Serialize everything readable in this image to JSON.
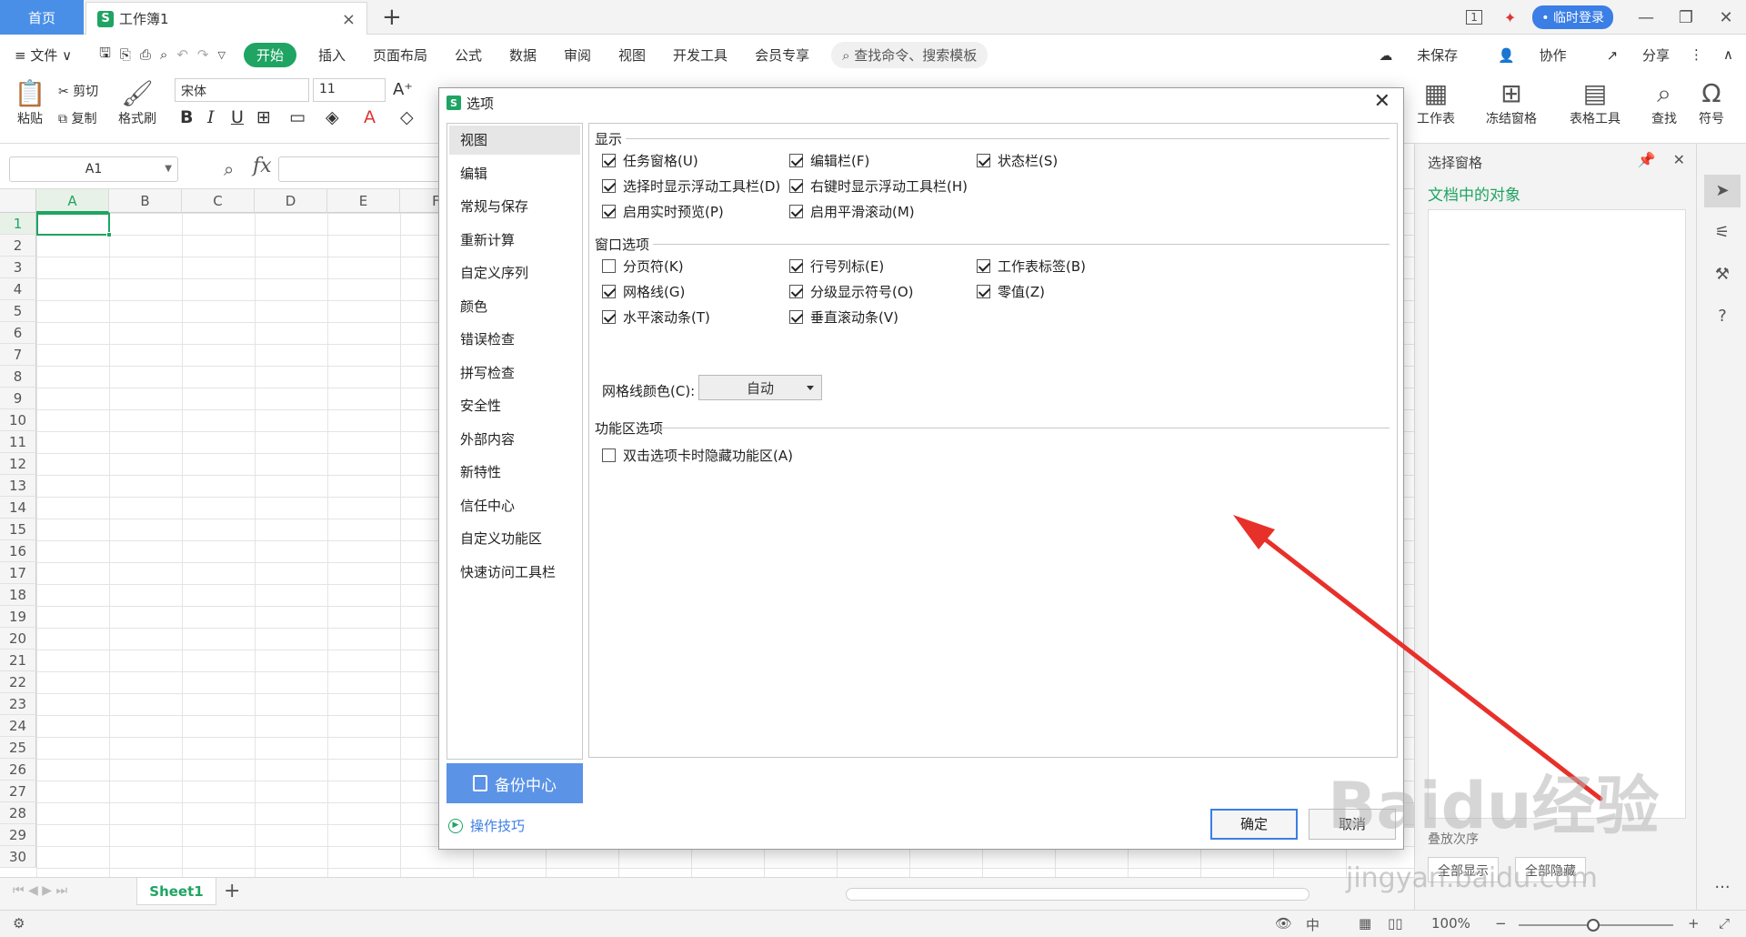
{
  "titlebar": {
    "home_tab": "首页",
    "doc_tab": "工作簿1",
    "doc_icon": "S",
    "close": "×",
    "add": "+",
    "login": "• 临时登录",
    "page_indicator": "1"
  },
  "menubar": {
    "file": "≡ 文件 ∨",
    "start": "开始",
    "items": [
      "插入",
      "页面布局",
      "公式",
      "数据",
      "审阅",
      "视图",
      "开发工具",
      "会员专享"
    ],
    "search": "查找命令、搜索模板",
    "unsaved": "未保存",
    "collab": "协作",
    "share": "分享"
  },
  "ribbon": {
    "paste": "粘贴",
    "cut": "剪切",
    "copy": "复制",
    "format_painter": "格式刷",
    "font_name": "宋体",
    "font_size": "11",
    "worksheet": "工作表",
    "freeze": "冻结窗格",
    "table_tools": "表格工具",
    "find": "查找",
    "symbol": "符号"
  },
  "formulabar": {
    "namebox": "A1",
    "fx": "fx"
  },
  "grid": {
    "columns": [
      "A",
      "B",
      "C",
      "D",
      "E",
      "F"
    ],
    "rows": [
      "1",
      "2",
      "3",
      "4",
      "5",
      "6",
      "7",
      "8",
      "9",
      "10",
      "11",
      "12",
      "13",
      "14",
      "15",
      "16",
      "17",
      "18",
      "19",
      "20",
      "21",
      "22",
      "23",
      "24",
      "25",
      "26",
      "27",
      "28",
      "29",
      "30"
    ]
  },
  "sheetbar": {
    "sheet1": "Sheet1",
    "add": "+"
  },
  "statusbar": {
    "zoom": "100%",
    "minus": "−",
    "plus": "+"
  },
  "taskpane": {
    "title": "选择窗格",
    "heading": "文档中的对象",
    "show_all": "全部显示",
    "hide_all": "全部隐藏",
    "order_label": "叠放次序"
  },
  "dialog": {
    "title": "选项",
    "icon": "S",
    "nav": [
      "视图",
      "编辑",
      "常规与保存",
      "重新计算",
      "自定义序列",
      "颜色",
      "错误检查",
      "拼写检查",
      "安全性",
      "外部内容",
      "新特性",
      "信任中心",
      "自定义功能区",
      "快速访问工具栏"
    ],
    "backup": "备份中心",
    "tips": "操作技巧",
    "sections": {
      "display": "显示",
      "window": "窗口选项",
      "ribbon": "功能区选项"
    },
    "display_options": [
      {
        "label": "任务窗格(U)",
        "checked": true
      },
      {
        "label": "编辑栏(F)",
        "checked": true
      },
      {
        "label": "状态栏(S)",
        "checked": true
      },
      {
        "label": "选择时显示浮动工具栏(D)",
        "checked": true
      },
      {
        "label": "右键时显示浮动工具栏(H)",
        "checked": true
      },
      {
        "label": "启用实时预览(P)",
        "checked": true
      },
      {
        "label": "启用平滑滚动(M)",
        "checked": true
      }
    ],
    "window_options": [
      {
        "label": "分页符(K)",
        "checked": false
      },
      {
        "label": "行号列标(E)",
        "checked": true
      },
      {
        "label": "工作表标签(B)",
        "checked": true
      },
      {
        "label": "网格线(G)",
        "checked": true
      },
      {
        "label": "分级显示符号(O)",
        "checked": true
      },
      {
        "label": "零值(Z)",
        "checked": true
      },
      {
        "label": "水平滚动条(T)",
        "checked": true
      },
      {
        "label": "垂直滚动条(V)",
        "checked": true
      }
    ],
    "gridline_color_label": "网格线颜色(C):",
    "gridline_color_value": "自动",
    "ribbon_options": [
      {
        "label": "双击选项卡时隐藏功能区(A)",
        "checked": false
      }
    ],
    "ok": "确定",
    "cancel": "取消"
  },
  "annotation_color": "#e8302a",
  "watermark": {
    "main": "Baidu经验",
    "sub": "jingyan.baidu.com"
  }
}
